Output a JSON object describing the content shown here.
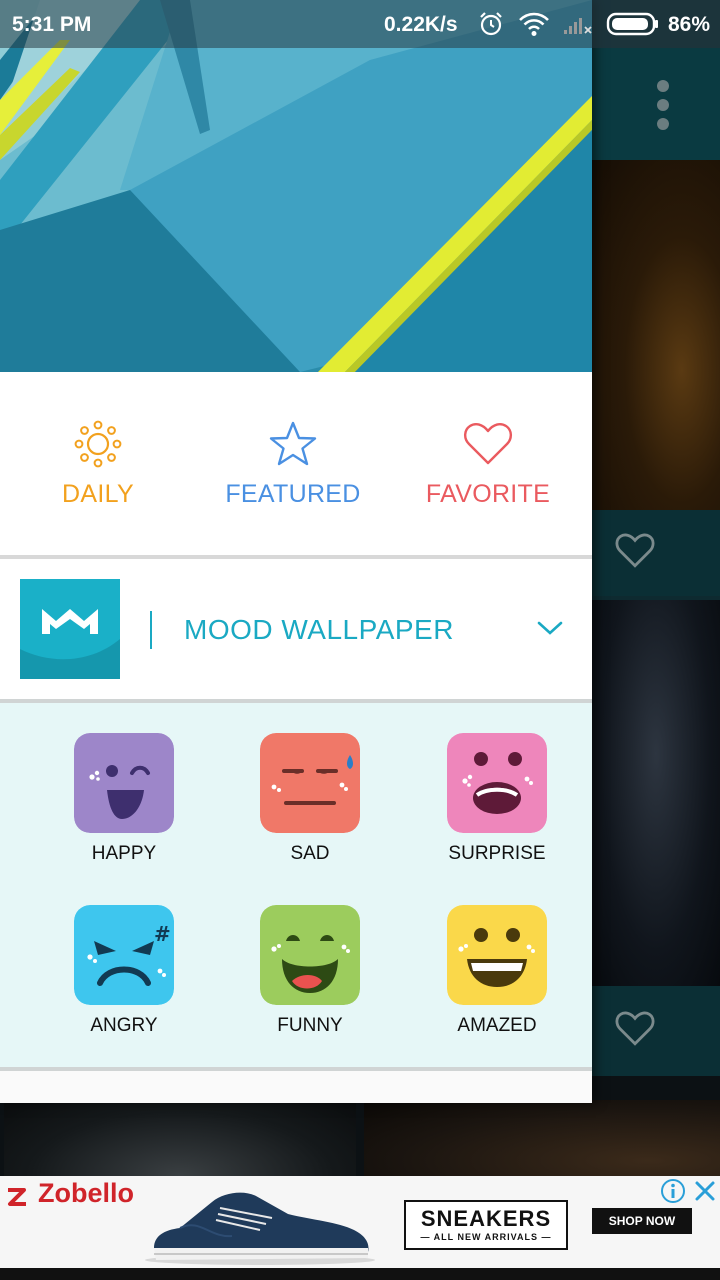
{
  "status_bar": {
    "time": "5:31 PM",
    "net_speed": "0.22K/s",
    "battery_pct": "86%",
    "icons": [
      "alarm-icon",
      "wifi-icon",
      "signal-icon",
      "battery-icon"
    ]
  },
  "drawer": {
    "header_image": "material-wallpaper",
    "quick_actions": [
      {
        "label": "DAILY",
        "icon": "sun-icon",
        "color": "#f2a11e"
      },
      {
        "label": "FEATURED",
        "icon": "star-icon",
        "color": "#4a90e2"
      },
      {
        "label": "FAVORITE",
        "icon": "heart-icon",
        "color": "#ea5a5f"
      }
    ],
    "category": {
      "title": "MOOD WALLPAPER",
      "logo": "mood-logo-icon",
      "accent": "#1aa9c3",
      "expand_icon": "chevron-down-icon"
    },
    "moods": [
      {
        "label": "HAPPY",
        "color": "#9d86c9"
      },
      {
        "label": "SAD",
        "color": "#f07868"
      },
      {
        "label": "SURPRISE",
        "color": "#ee86bb"
      },
      {
        "label": "ANGRY",
        "color": "#3ec6ee"
      },
      {
        "label": "FUNNY",
        "color": "#9ccc5d"
      },
      {
        "label": "AMAZED",
        "color": "#fad84a"
      }
    ]
  },
  "ad": {
    "brand": "Zobello",
    "headline": "SNEAKERS",
    "subheadline": "— ALL NEW ARRIVALS —",
    "cta": "SHOP NOW",
    "icons": [
      "ad-info-icon",
      "ad-close-icon"
    ]
  }
}
